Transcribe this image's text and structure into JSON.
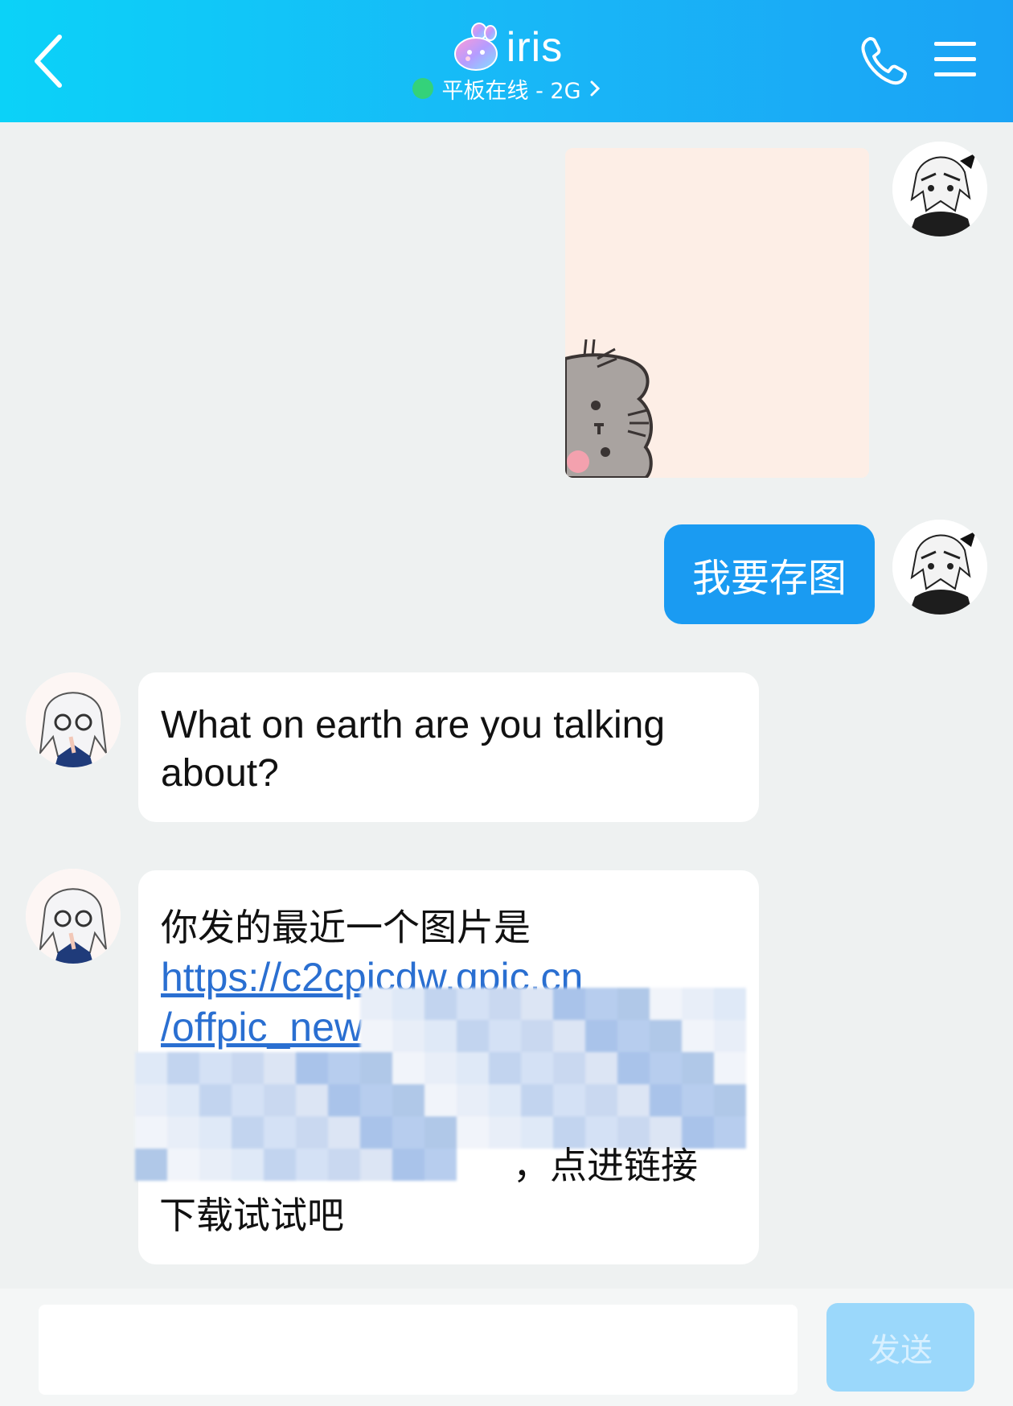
{
  "header": {
    "contact_name": "iris",
    "status_text": "平板在线 - 2G",
    "online_color": "#34d27a"
  },
  "messages": [
    {
      "direction": "out",
      "type": "image"
    },
    {
      "direction": "out",
      "type": "text",
      "text": "我要存图"
    },
    {
      "direction": "in",
      "type": "text",
      "text": "What on earth are you talking about?"
    },
    {
      "direction": "in",
      "type": "text",
      "text_line1": "你发的最近一个图片是",
      "link_visible": "https://c2cpicdw.qpic.cn",
      "link_partial": "/offpic_new",
      "text_after_link": "，点进链接",
      "text_last": "下载试试吧"
    }
  ],
  "input": {
    "placeholder": "",
    "send_label": "发送"
  },
  "colors": {
    "accent": "#1a9bf2",
    "header_start": "#0bd2f8",
    "header_end": "#1aa3f5"
  }
}
